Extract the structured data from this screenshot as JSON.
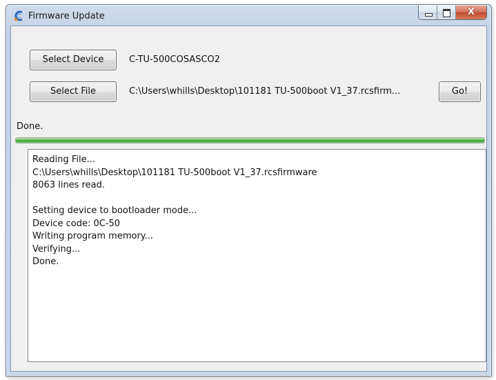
{
  "window": {
    "title": "Firmware Update",
    "icon": "firmware-app-icon",
    "caption_buttons": [
      "minimize",
      "maximize",
      "close"
    ],
    "close_glyph": "X"
  },
  "device": {
    "button_label": "Select Device",
    "value": "C-TU-500COSASCO2"
  },
  "file": {
    "button_label": "Select File",
    "value": "C:\\Users\\whills\\Desktop\\101181 TU-500boot V1_37.rcsfirm...",
    "go_label": "Go!"
  },
  "status": {
    "text": "Done.",
    "progress_percent": 100,
    "progress_color": "#3aa12f"
  },
  "log": {
    "lines": [
      "Reading File...",
      "C:\\Users\\whills\\Desktop\\101181 TU-500boot V1_37.rcsfirmware",
      "8063 lines read.",
      "",
      "Setting device to bootloader mode...",
      "Device code: 0C-50",
      "Writing program memory...",
      "Verifying...",
      "Done."
    ]
  }
}
